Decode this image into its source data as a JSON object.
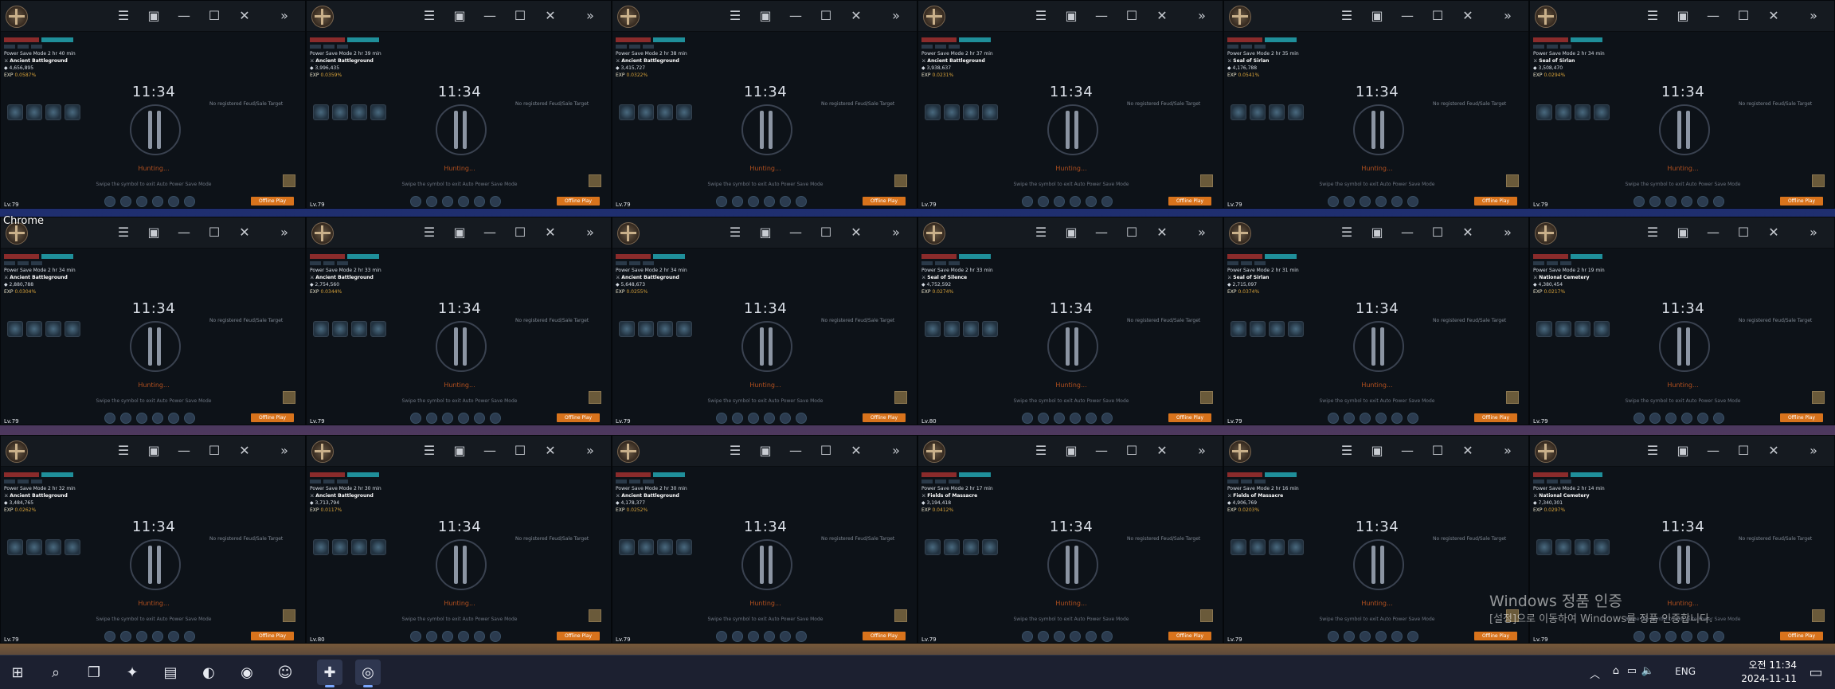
{
  "app": {
    "name": "Chrome"
  },
  "window_buttons": {
    "menu": "☰",
    "layout": "▣",
    "minimize": "—",
    "maximize": "☐",
    "close": "✕",
    "more": "»"
  },
  "common": {
    "clock": "11:34",
    "mode_label": "Power Save Mode",
    "hunting": "Hunting...",
    "swipe_hint": "Swipe the symbol to exit Auto Power Save Mode",
    "no_target": "No registered Feud/Sale Target",
    "offline_button": "Offline Play",
    "exp_label": "EXP"
  },
  "windows": [
    {
      "id": 1,
      "duration": "2 hr 40 min",
      "zone": "Ancient Battleground",
      "gold": "4,656,895",
      "exp": "0.0587%",
      "level": "Lv.79"
    },
    {
      "id": 2,
      "duration": "2 hr 39 min",
      "zone": "Ancient Battleground",
      "gold": "3,996,435",
      "exp": "0.0359%",
      "level": "Lv.79"
    },
    {
      "id": 3,
      "duration": "2 hr 38 min",
      "zone": "Ancient Battleground",
      "gold": "3,415,727",
      "exp": "0.0322%",
      "level": "Lv.79"
    },
    {
      "id": 4,
      "duration": "2 hr 37 min",
      "zone": "Ancient Battleground",
      "gold": "3,938,637",
      "exp": "0.0231%",
      "level": "Lv.79"
    },
    {
      "id": 5,
      "duration": "2 hr 35 min",
      "zone": "Seal of Sirlan",
      "gold": "4,176,788",
      "exp": "0.0541%",
      "level": "Lv.79"
    },
    {
      "id": 6,
      "duration": "2 hr 34 min",
      "zone": "Seal of Sirlan",
      "gold": "3,508,470",
      "exp": "0.0294%",
      "level": "Lv.79"
    },
    {
      "id": 7,
      "duration": "2 hr 34 min",
      "zone": "Ancient Battleground",
      "gold": "2,880,788",
      "exp": "0.0304%",
      "level": "Lv.79"
    },
    {
      "id": 8,
      "duration": "2 hr 33 min",
      "zone": "Ancient Battleground",
      "gold": "2,754,560",
      "exp": "0.0344%",
      "level": "Lv.79"
    },
    {
      "id": 9,
      "duration": "2 hr 34 min",
      "zone": "Ancient Battleground",
      "gold": "5,648,673",
      "exp": "0.0255%",
      "level": "Lv.79"
    },
    {
      "id": 10,
      "duration": "2 hr 33 min",
      "zone": "Seal of Silence",
      "gold": "4,752,592",
      "exp": "0.0274%",
      "level": "Lv.80"
    },
    {
      "id": 11,
      "duration": "2 hr 31 min",
      "zone": "Seal of Sirlan",
      "gold": "2,715,097",
      "exp": "0.0374%",
      "level": "Lv.79"
    },
    {
      "id": 12,
      "duration": "2 hr 19 min",
      "zone": "National Cemetery",
      "gold": "4,380,454",
      "exp": "0.0217%",
      "level": "Lv.79"
    },
    {
      "id": 13,
      "duration": "2 hr 32 min",
      "zone": "Ancient Battleground",
      "gold": "3,484,765",
      "exp": "0.0262%",
      "level": "Lv.79"
    },
    {
      "id": 14,
      "duration": "2 hr 30 min",
      "zone": "Ancient Battleground",
      "gold": "3,713,794",
      "exp": "0.0117%",
      "level": "Lv.80"
    },
    {
      "id": 15,
      "duration": "2 hr 30 min",
      "zone": "Ancient Battleground",
      "gold": "4,178,377",
      "exp": "0.0252%",
      "level": "Lv.79"
    },
    {
      "id": 16,
      "duration": "2 hr 17 min",
      "zone": "Fields of Massacre",
      "gold": "3,194,418",
      "exp": "0.0412%",
      "level": "Lv.79"
    },
    {
      "id": 17,
      "duration": "2 hr 16 min",
      "zone": "Fields of Massacre",
      "gold": "4,906,769",
      "exp": "0.0203%",
      "level": "Lv.79"
    },
    {
      "id": 18,
      "duration": "2 hr 14 min",
      "zone": "National Cemetery",
      "gold": "7,340,301",
      "exp": "0.0297%",
      "level": "Lv.79"
    }
  ],
  "watermark": {
    "title": "Windows 정품 인증",
    "subtitle": "[설정]으로 이동하여 Windows를 정품 인증합니다."
  },
  "taskbar": {
    "items": [
      {
        "name": "windows-start",
        "glyph": "⊞"
      },
      {
        "name": "search",
        "glyph": "⌕"
      },
      {
        "name": "task-view",
        "glyph": "❐"
      },
      {
        "name": "copilot",
        "glyph": "✦"
      },
      {
        "name": "file-explorer",
        "glyph": "▤"
      },
      {
        "name": "edge",
        "glyph": "◐"
      },
      {
        "name": "chrome",
        "glyph": "◉"
      },
      {
        "name": "discord",
        "glyph": "☺"
      },
      {
        "name": "game-client",
        "glyph": "✚"
      },
      {
        "name": "purple-app",
        "glyph": "◎"
      }
    ],
    "tray": {
      "language": "ENG",
      "time": "오전 11:34",
      "date": "2024-11-11"
    }
  }
}
